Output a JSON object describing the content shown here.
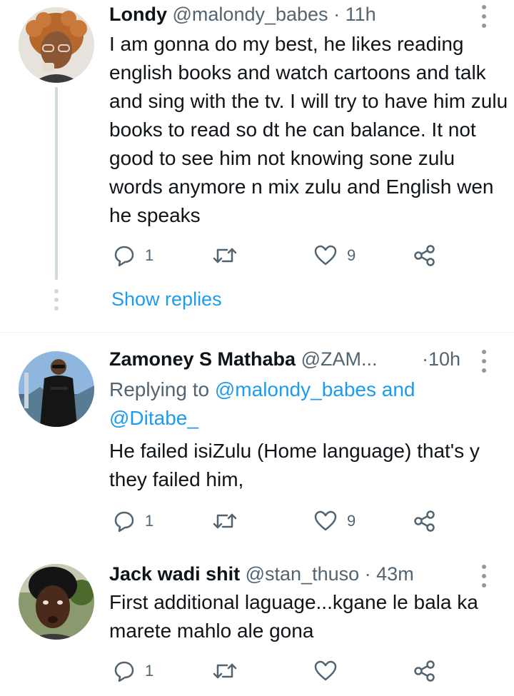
{
  "tweets": [
    {
      "name": "Londy",
      "handle": "@malondy_babes",
      "dot": "·",
      "time": "11h",
      "text": "I am gonna do my best, he likes reading english books and watch cartoons and talk and sing with the tv. I will try to have him zulu books to read so dt he can balance. It not good to see him not knowing sone zulu words anymore n mix zulu and English wen he speaks",
      "replies": "1",
      "retweets": "",
      "likes": "9",
      "show_replies": "Show replies"
    },
    {
      "name": "Zamoney S Mathaba",
      "handle": "@ZAM...",
      "dot": "·",
      "time": "10h",
      "replying_prefix": "Replying to",
      "replying_to_1": "@malondy_babes",
      "replying_and": "and",
      "replying_to_2": "@Ditabe_",
      "text": "He failed isiZulu (Home language) that's y they failed him,",
      "replies": "1",
      "retweets": "",
      "likes": "9"
    },
    {
      "name": "Jack wadi shit",
      "handle": "@stan_thuso",
      "dot": "·",
      "time": "43m",
      "text": "First additional laguage...kgane le bala ka marete mahlo ale gona",
      "replies": "1",
      "retweets": "",
      "likes": ""
    }
  ],
  "icons": {
    "reply": "reply-icon",
    "retweet": "retweet-icon",
    "like": "heart-icon",
    "share": "share-icon",
    "more": "more-options-icon"
  },
  "colors": {
    "accent": "#1d9bf0",
    "secondary_text": "#536471",
    "thread_line": "#cfd9de"
  }
}
